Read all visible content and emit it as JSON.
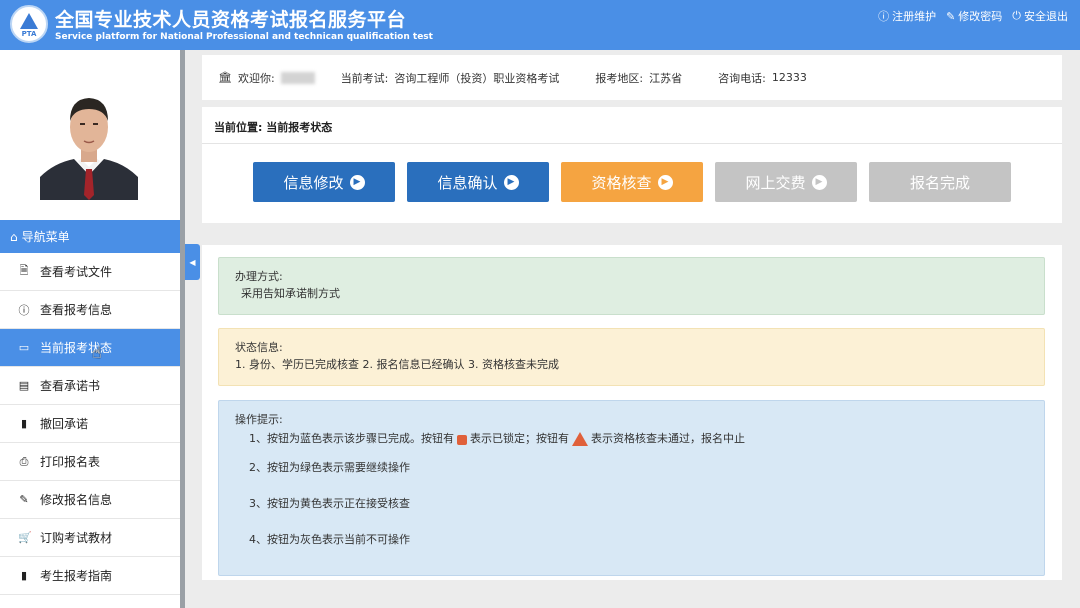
{
  "header": {
    "logo_text": "PTA",
    "title_cn": "全国专业技术人员资格考试报名服务平台",
    "title_en": "Service platform for National Professional and technican qualification test",
    "links": [
      {
        "label": "注册维护",
        "icon": "info-icon"
      },
      {
        "label": "修改密码",
        "icon": "edit-icon"
      },
      {
        "label": "安全退出",
        "icon": "power-icon"
      }
    ]
  },
  "sidebar": {
    "nav_title": "导航菜单",
    "items": [
      {
        "label": "查看考试文件",
        "icon": "document-icon"
      },
      {
        "label": "查看报考信息",
        "icon": "info-icon"
      },
      {
        "label": "当前报考状态",
        "icon": "monitor-icon"
      },
      {
        "label": "查看承诺书",
        "icon": "card-icon"
      },
      {
        "label": "撤回承诺",
        "icon": "book-icon"
      },
      {
        "label": "打印报名表",
        "icon": "print-icon"
      },
      {
        "label": "修改报名信息",
        "icon": "edit-icon"
      },
      {
        "label": "订购考试教材",
        "icon": "cart-icon"
      },
      {
        "label": "考生报考指南",
        "icon": "book-icon"
      }
    ]
  },
  "info": {
    "welcome_label": "欢迎你:",
    "exam_label": "当前考试:",
    "exam_value": "咨询工程师（投资）职业资格考试",
    "region_label": "报考地区:",
    "region_value": "江苏省",
    "phone_label": "咨询电话:",
    "phone_value": "12333"
  },
  "breadcrumb": "当前位置: 当前报考状态",
  "steps": [
    {
      "label": "信息修改",
      "color": "#2a6fbd",
      "arrow": true
    },
    {
      "label": "信息确认",
      "color": "#2a6fbd",
      "arrow": true
    },
    {
      "label": "资格核查",
      "color": "#f5a441",
      "arrow": true
    },
    {
      "label": "网上交费",
      "color": "#c4c4c4",
      "arrow": true
    },
    {
      "label": "报名完成",
      "color": "#c4c4c4",
      "arrow": false
    }
  ],
  "method": {
    "title": "办理方式:",
    "value": "采用告知承诺制方式"
  },
  "status": {
    "title": "状态信息:",
    "value": "1. 身份、学历已完成核查 2. 报名信息已经确认 3. 资格核查未完成"
  },
  "hints": {
    "title": "操作提示:",
    "line1_a": "1、按钮为蓝色表示该步骤已完成。按钮有",
    "line1_b": "表示已锁定；按钮有",
    "line1_c": "表示资格核查未通过，报名中止",
    "line2": "2、按钮为绿色表示需要继续操作",
    "line3": "3、按钮为黄色表示正在接受核查",
    "line4": "4、按钮为灰色表示当前不可操作"
  }
}
